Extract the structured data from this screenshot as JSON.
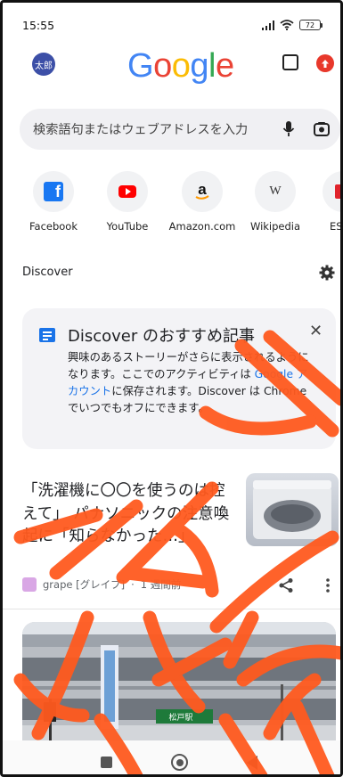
{
  "status_bar": {
    "time": "15:55",
    "battery": "72"
  },
  "account": {
    "avatar_text": "太郎"
  },
  "logo": {
    "letters": [
      {
        "char": "G",
        "color": "#4285f4"
      },
      {
        "char": "o",
        "color": "#ea4335"
      },
      {
        "char": "o",
        "color": "#fbbc05"
      },
      {
        "char": "g",
        "color": "#4285f4"
      },
      {
        "char": "l",
        "color": "#34a853"
      },
      {
        "char": "e",
        "color": "#ea4335"
      }
    ]
  },
  "search": {
    "placeholder": "検索語句またはウェブアドレスを入力"
  },
  "shortcuts": [
    {
      "label": "Facebook",
      "icon": "facebook-icon"
    },
    {
      "label": "YouTube",
      "icon": "youtube-icon"
    },
    {
      "label": "Amazon.com",
      "icon": "amazon-icon"
    },
    {
      "label": "Wikipedia",
      "icon": "wikipedia-icon"
    },
    {
      "label": "ESPN",
      "icon": "espn-icon"
    }
  ],
  "discover": {
    "header": "Discover",
    "promo": {
      "title": "Discover のおすすめ記事",
      "body_1": "興味のあるストーリーがさらに表示されるようになります。ここでのアクティビティは ",
      "body_link": "Google アカウント",
      "body_2": "に保存されます。Discover は Chrome でいつでもオフにできます。"
    },
    "article": {
      "title": "「洗濯機に〇〇を使うのは控えて」 パナソニックの注意喚起に「知らなかった…」",
      "source": "grape [グレイプ]",
      "time": "1 週間前",
      "separator": "·"
    },
    "photo_sign": "松戸駅"
  },
  "colors": {
    "accent": "#1a73e8",
    "scribble": "#ff5a1f",
    "update_badge": "#e8382b"
  }
}
